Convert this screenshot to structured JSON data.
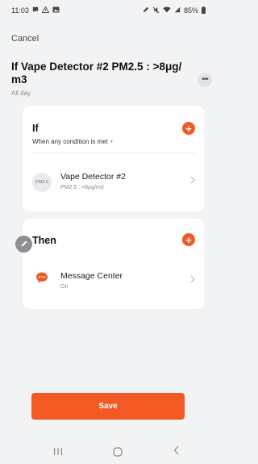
{
  "status_bar": {
    "time": "11:03",
    "battery": "85%",
    "left_icons": [
      "chat-bubble-icon",
      "warning-icon",
      "gallery-icon"
    ],
    "right_icons": [
      "pen-icon",
      "mute-icon",
      "wifi-icon",
      "signal-icon",
      "battery-icon"
    ]
  },
  "header": {
    "cancel_label": "Cancel",
    "title": "If Vape Detector #2 PM2.5 : >8μg/ m3",
    "subtitle": "All day",
    "more_icon": "more-dots-icon"
  },
  "if_card": {
    "title": "If",
    "description": "When any condition is met",
    "add_icon": "plus-icon",
    "condition": {
      "icon_text": "PM2.5",
      "name": "Vape Detector #2",
      "detail": "PM2.5 : >8μg/m3"
    }
  },
  "then_card": {
    "title": "Then",
    "add_icon": "plus-icon",
    "action": {
      "icon": "message-icon",
      "name": "Message Center",
      "detail": "On"
    }
  },
  "save_label": "Save",
  "colors": {
    "accent": "#f35a23",
    "background": "#f2f3f5",
    "card": "#ffffff"
  }
}
